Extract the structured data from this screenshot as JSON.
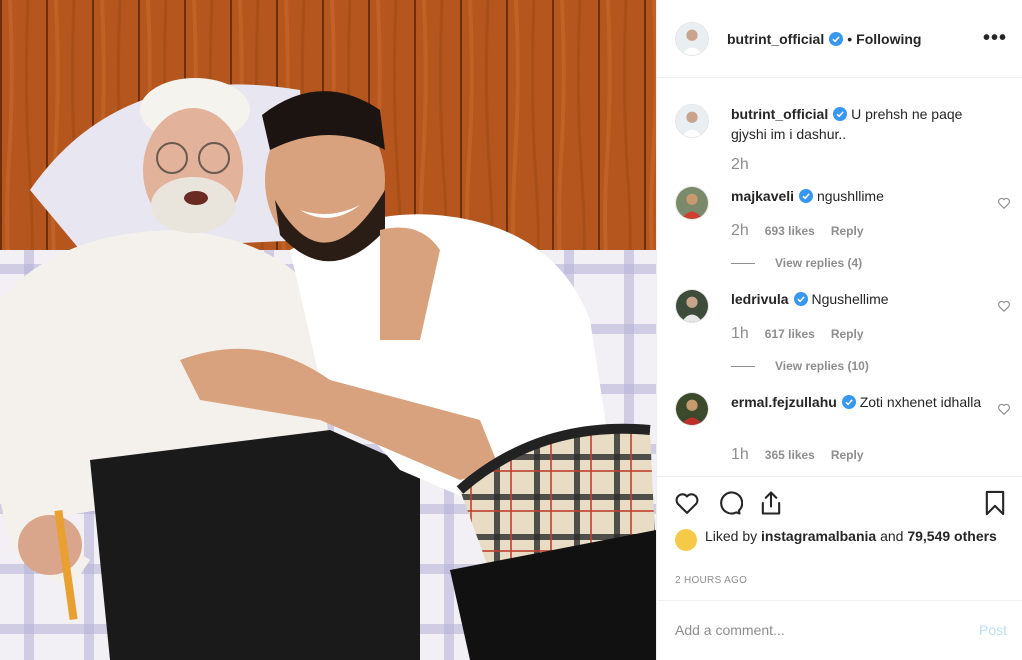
{
  "header": {
    "username": "butrint_official",
    "separator": "•",
    "follow_status": "Following",
    "more_label": "•••"
  },
  "caption": {
    "username": "butrint_official",
    "text": "U prehsh ne paqe gjyshi im i dashur..",
    "time": "2h"
  },
  "comments": [
    {
      "username": "majkaveli",
      "text": "ngushllime",
      "time": "2h",
      "likes": "693 likes",
      "reply": "Reply",
      "view_replies": "View replies (4)"
    },
    {
      "username": "ledrivula",
      "text": "Ngushellime",
      "time": "1h",
      "likes": "617 likes",
      "reply": "Reply",
      "view_replies": "View replies (10)"
    },
    {
      "username": "ermal.fejzullahu",
      "text": "Zoti nxhenet idhalla",
      "time": "1h",
      "likes": "365 likes",
      "reply": "Reply"
    }
  ],
  "likes": {
    "prefix": "Liked by",
    "user": "instagramalbania",
    "connector": "and",
    "others": "79,549 others"
  },
  "timestamp": "2 HOURS AGO",
  "add_comment": {
    "placeholder": "Add a comment...",
    "post_label": "Post"
  },
  "icons": {
    "like": "heart-icon",
    "comment": "comment-icon",
    "share": "share-icon",
    "save": "bookmark-icon",
    "verified": "verified-badge-icon"
  },
  "colors": {
    "verified": "#3897f0",
    "text": "#262626",
    "muted": "#8e8e8e",
    "post_disabled": "#b9dffc",
    "border": "#efefef"
  }
}
